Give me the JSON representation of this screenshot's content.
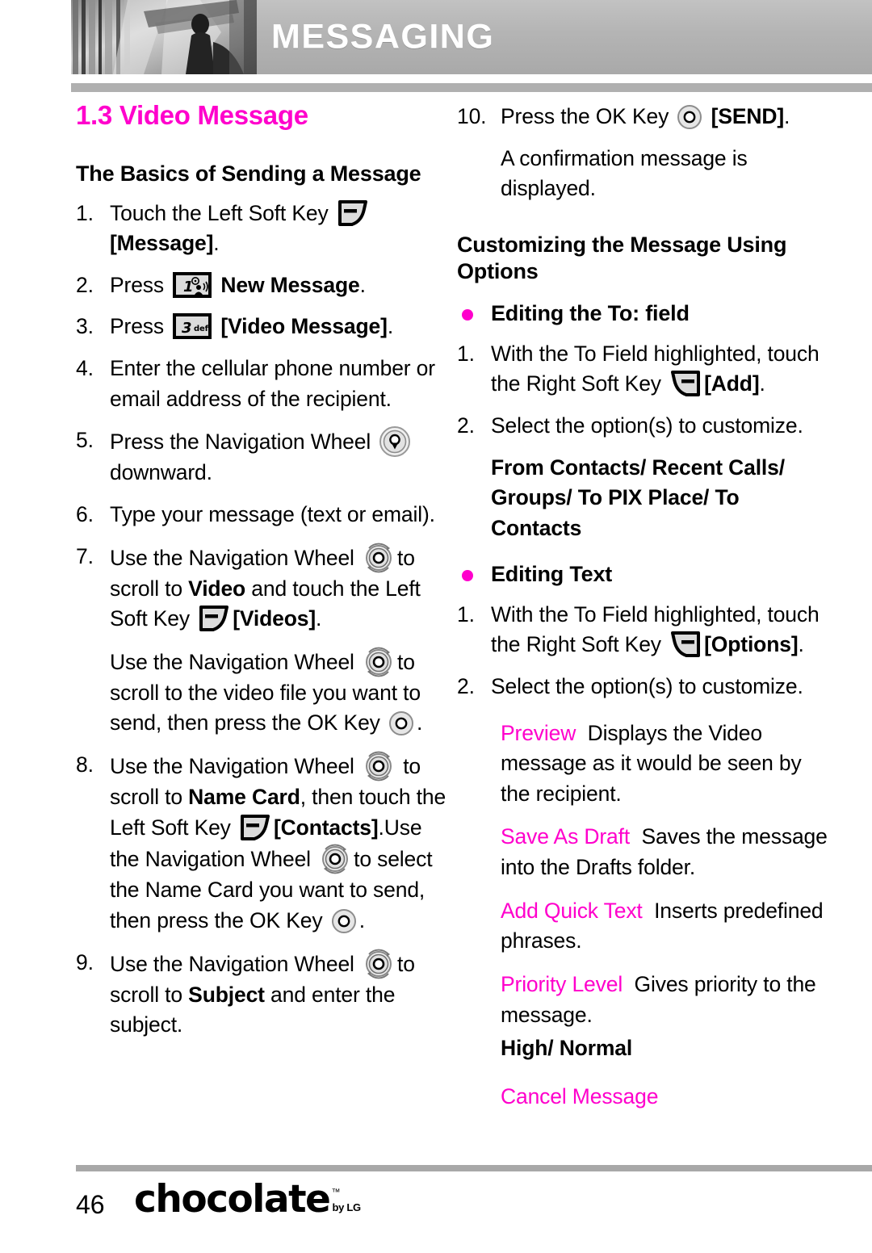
{
  "header": {
    "title": "MESSAGING",
    "photo_alt": "grayscale-photo-strip"
  },
  "colors": {
    "accent_magenta": "#ff00cc",
    "header_gray": "#b4b4b4",
    "rule_gray": "#b0b0b0",
    "key_fill": "#e0e0e0"
  },
  "left_column": {
    "section_title": "1.3 Video Message",
    "subhead": "The Basics of Sending a Message",
    "steps": [
      {
        "num": "1.",
        "parts": [
          {
            "t": "text",
            "v": "Touch the Left Soft Key "
          },
          {
            "t": "icon",
            "v": "left-soft-key-icon"
          },
          {
            "t": "bold",
            "v": " [Message]"
          },
          {
            "t": "text",
            "v": "."
          }
        ],
        "plain": "Touch the Left Soft Key [Message]."
      },
      {
        "num": "2.",
        "plain": "Press 1 New Message."
      },
      {
        "num": "3.",
        "plain": "Press 3 [Video Message]."
      },
      {
        "num": "4.",
        "plain": "Enter the cellular phone number or email address of the recipient."
      },
      {
        "num": "5.",
        "plain": "Press the Navigation Wheel downward."
      },
      {
        "num": "6.",
        "plain": "Type your message (text or email)."
      },
      {
        "num": "7.",
        "plain": "Use the Navigation Wheel to scroll to Video and touch the Left Soft Key [Videos]."
      },
      {
        "num": "",
        "plain": "Use the Navigation Wheel to scroll to the video file you want to send, then press the OK Key ."
      },
      {
        "num": "8.",
        "plain": "Use the Navigation Wheel to scroll to Name Card, then touch the Left Soft Key [Contacts]. Use the Navigation Wheel to select the Name Card you want to send, then press the OK Key ."
      },
      {
        "num": "9.",
        "plain": "Use the Navigation Wheel to scroll to Subject and enter the subject."
      }
    ],
    "step1": {
      "pre": "Touch the Left Soft Key ",
      "bold": "[Message]",
      "post": "."
    },
    "step2": {
      "pre": "Press ",
      "bold": " New Message",
      "post": ".",
      "key_label": "1",
      "key_sub": "@"
    },
    "step3": {
      "pre": "Press ",
      "bold": " [Video Message]",
      "post": ".",
      "key_label": "3",
      "key_sub": "def"
    },
    "step4": {
      "text": "Enter the cellular phone number or email address of the recipient."
    },
    "step5": {
      "pre": "Press the Navigation Wheel ",
      "post": "downward."
    },
    "step6": {
      "text": "Type your message (text or email)."
    },
    "step7": {
      "a_pre": "Use the Navigation Wheel ",
      "a_mid": "to scroll to ",
      "a_bold1": "Video",
      "a_mid2": " and touch the Left Soft Key ",
      "a_bold2": "[Videos]",
      "a_end": ".",
      "b_pre": "Use the Navigation Wheel ",
      "b_mid": "to scroll to the video file you want to send, then press the OK Key ",
      "b_end": "."
    },
    "step8": {
      "a_pre": "Use the Navigation Wheel ",
      "a_post": " to scroll to ",
      "a_bold1": "Name Card",
      "a_mid": ", then touch the Left Soft Key ",
      "a_bold2": "[Contacts]",
      "a_end": ".",
      "b_pre": "Use the Navigation Wheel ",
      "b_mid": "to select the Name Card you want to send, then press the OK Key ",
      "b_end": "."
    },
    "step9": {
      "pre": "Use the Navigation Wheel ",
      "mid": "to scroll to ",
      "bold": "Subject",
      "post": " and enter the subject."
    }
  },
  "right_column": {
    "step10": {
      "num": "10.",
      "pre": "Press the OK Key ",
      "bold": "[SEND]",
      "post": ".",
      "cont": "A confirmation message is displayed."
    },
    "subhead": "Customizing the Message Using Options",
    "bullet1": "Editing the To: field",
    "b1_step1": {
      "num": "1.",
      "pre": "With the To Field highlighted, touch the Right Soft Key ",
      "bold": "[Add]",
      "post": "."
    },
    "b1_step2": {
      "num": "2.",
      "text": "Select the option(s) to customize.",
      "values": "From Contacts/ Recent Calls/ Groups/ To PIX Place/ To Contacts"
    },
    "bullet2": "Editing Text",
    "b2_step1": {
      "num": "1.",
      "pre": "With the To Field highlighted, touch the Right Soft Key ",
      "bold": "[Options]",
      "post": "."
    },
    "b2_step2": {
      "num": "2.",
      "text": "Select the option(s) to customize."
    },
    "options": [
      {
        "name": "Preview",
        "desc": "Displays the Video message as it would be seen by the recipient.",
        "values": ""
      },
      {
        "name": "Save As Draft",
        "desc": "Saves the message into the Drafts folder.",
        "values": ""
      },
      {
        "name": "Add Quick Text",
        "desc": "Inserts predefined phrases.",
        "values": ""
      },
      {
        "name": "Priority Level",
        "desc": "Gives priority to the message.",
        "values": "High/ Normal"
      },
      {
        "name": "Cancel Message",
        "desc": "",
        "values": ""
      }
    ]
  },
  "footer": {
    "page_number": "46",
    "logo_word": "chocolate",
    "logo_tm": "™",
    "logo_by": "by LG"
  }
}
